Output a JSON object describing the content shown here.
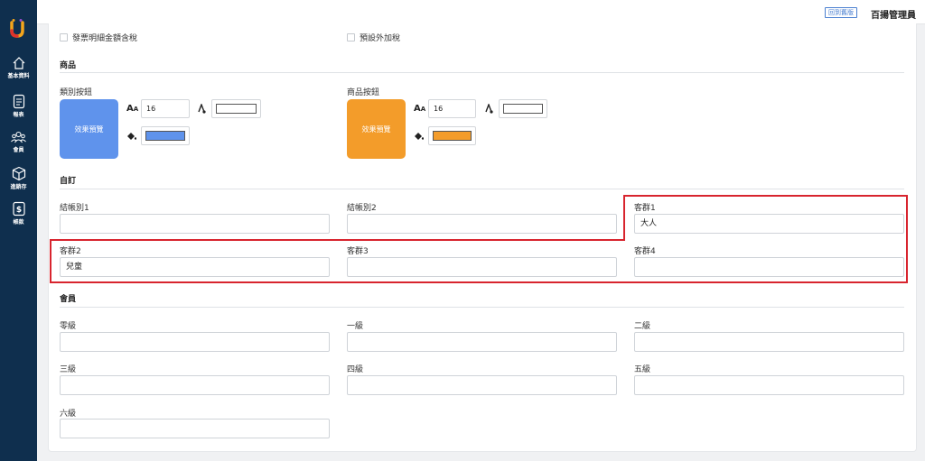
{
  "nav": {
    "items": [
      {
        "label": "基本資料"
      },
      {
        "label": "報表"
      },
      {
        "label": "會員"
      },
      {
        "label": "進銷存"
      },
      {
        "label": "帳款"
      }
    ]
  },
  "header": {
    "old_version_label": "回到舊版",
    "user_name": "百揚管理員"
  },
  "invoice": {
    "tax_included_label": "發票明細金額含稅",
    "default_extra_tax_label": "預設外加稅"
  },
  "product": {
    "title": "商品",
    "category_button": {
      "label": "類別按鈕",
      "preview_text": "效果預覽",
      "font_size": "16",
      "font_color": "#ffffff",
      "bg_color": "#5f93ec"
    },
    "product_button": {
      "label": "商品按鈕",
      "preview_text": "效果預覽",
      "font_size": "16",
      "font_color": "#ffffff",
      "bg_color": "#f39c2a"
    }
  },
  "custom": {
    "title": "自訂",
    "fields": [
      {
        "label": "結帳別1",
        "value": ""
      },
      {
        "label": "結帳別2",
        "value": ""
      },
      {
        "label": "客群1",
        "value": "大人"
      },
      {
        "label": "客群2",
        "value": "兒童"
      },
      {
        "label": "客群3",
        "value": ""
      },
      {
        "label": "客群4",
        "value": ""
      }
    ]
  },
  "member": {
    "title": "會員",
    "levels": [
      {
        "label": "零級",
        "value": ""
      },
      {
        "label": "一級",
        "value": ""
      },
      {
        "label": "二級",
        "value": ""
      },
      {
        "label": "三級",
        "value": ""
      },
      {
        "label": "四級",
        "value": ""
      },
      {
        "label": "五級",
        "value": ""
      },
      {
        "label": "六級",
        "value": ""
      }
    ]
  },
  "colors": {
    "sidebar": "#0f2f4e",
    "highlight": "#d8242e",
    "link": "#4a7fd0"
  },
  "icons": {
    "logo": "brand-logo-icon",
    "font_size": "font-size-icon",
    "font_color": "font-color-icon",
    "fill_color": "paint-bucket-icon"
  }
}
